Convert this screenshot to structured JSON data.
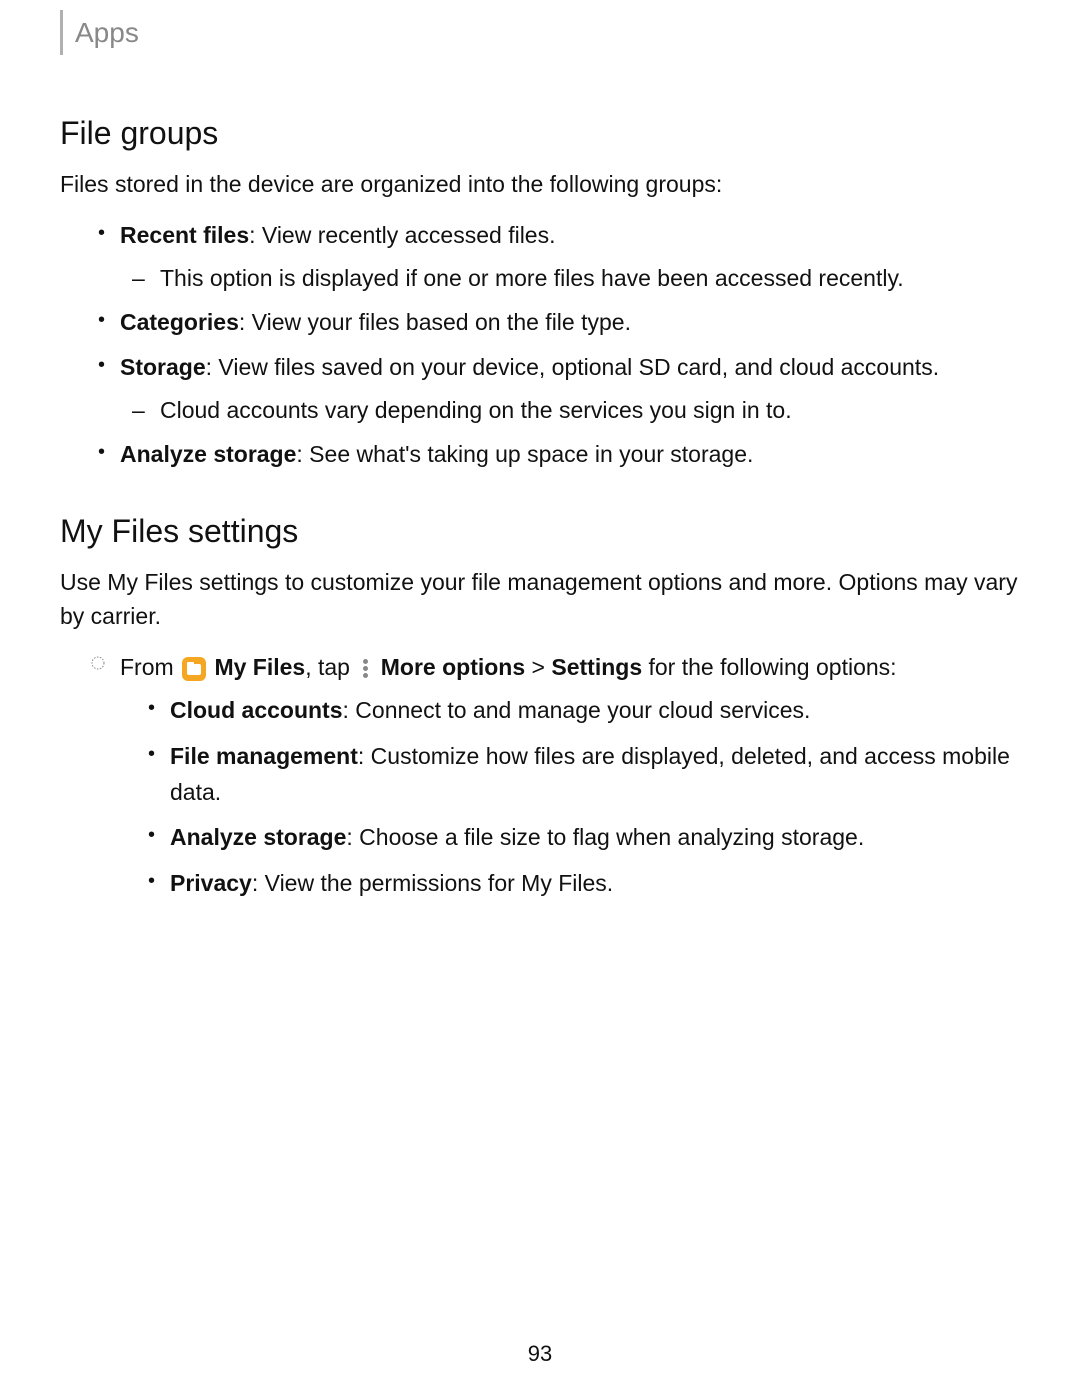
{
  "header": {
    "title": "Apps"
  },
  "section1": {
    "title": "File groups",
    "intro": "Files stored in the device are organized into the following groups:",
    "items": [
      {
        "label": "Recent files",
        "desc": ": View recently accessed files.",
        "sub": [
          "This option is displayed if one or more files have been accessed recently."
        ]
      },
      {
        "label": "Categories",
        "desc": ": View your files based on the file type."
      },
      {
        "label": "Storage",
        "desc": ": View files saved on your device, optional SD card, and cloud accounts.",
        "sub": [
          "Cloud accounts vary depending on the services you sign in to."
        ]
      },
      {
        "label": "Analyze storage",
        "desc": ": See what's taking up space in your storage."
      }
    ]
  },
  "section2": {
    "title": "My Files settings",
    "intro": "Use My Files settings to customize your file management options and more. Options may vary by carrier.",
    "from_prefix": "From ",
    "my_files_label": "My Files",
    "tap_text": ", tap ",
    "more_options_label": "More options",
    "gt": " > ",
    "settings_label": "Settings",
    "after_text": " for the following options:",
    "options": [
      {
        "label": "Cloud accounts",
        "desc": ": Connect to and manage your cloud services."
      },
      {
        "label": "File management",
        "desc": ": Customize how files are displayed, deleted, and access mobile data."
      },
      {
        "label": "Analyze storage",
        "desc": ": Choose a file size to flag when analyzing storage."
      },
      {
        "label": "Privacy",
        "desc": ": View the permissions for My Files."
      }
    ]
  },
  "page_number": "93"
}
